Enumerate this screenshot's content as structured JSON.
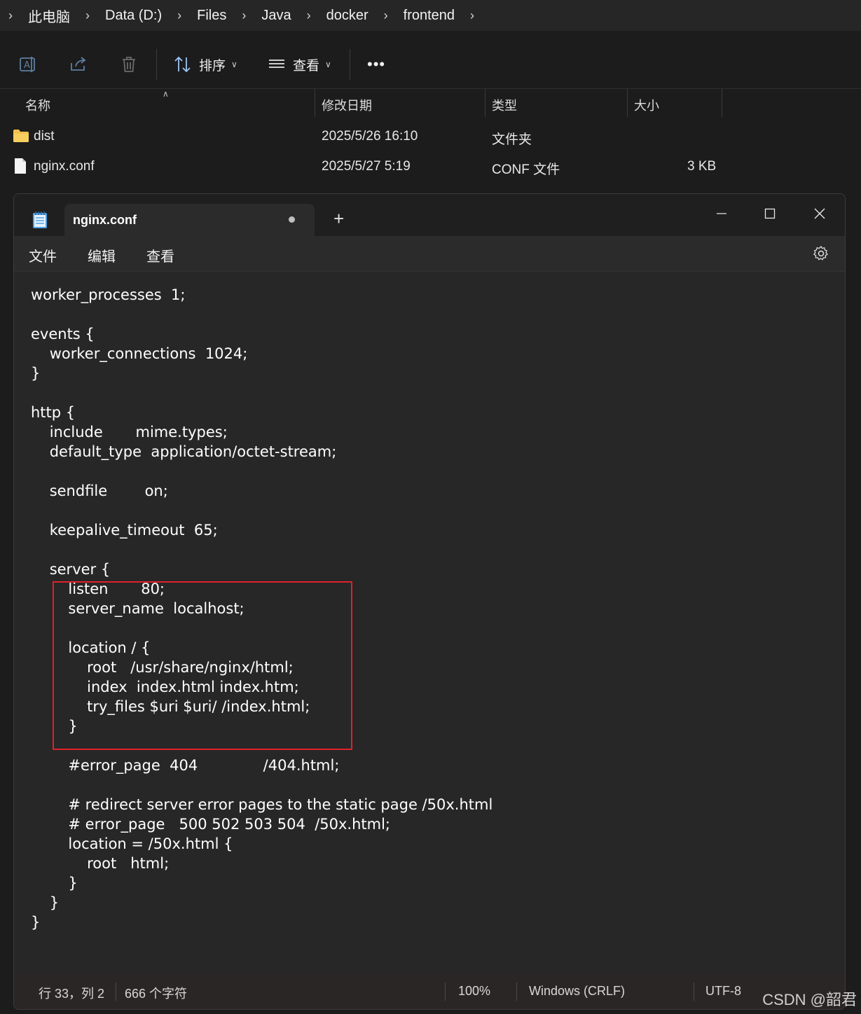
{
  "breadcrumb": [
    "此电脑",
    "Data (D:)",
    "Files",
    "Java",
    "docker",
    "frontend"
  ],
  "toolbar": {
    "sort_label": "排序",
    "view_label": "查看",
    "more_label": "•••"
  },
  "columns": {
    "name": "名称",
    "modified": "修改日期",
    "type": "类型",
    "size": "大小"
  },
  "files": [
    {
      "name": "dist",
      "modified": "2025/5/26 16:10",
      "type": "文件夹",
      "size": "",
      "icon": "folder-icon"
    },
    {
      "name": "nginx.conf",
      "modified": "2025/5/27 5:19",
      "type": "CONF 文件",
      "size": "3 KB",
      "icon": "file-icon"
    }
  ],
  "notepad": {
    "tab_title": "nginx.conf",
    "menu": {
      "file": "文件",
      "edit": "编辑",
      "view": "查看"
    },
    "content": "worker_processes  1;\n\nevents {\n    worker_connections  1024;\n}\n\nhttp {\n    include       mime.types;\n    default_type  application/octet-stream;\n\n    sendfile        on;\n\n    keepalive_timeout  65;\n\n    server {\n        listen       80;\n        server_name  localhost;\n\n        location / {\n            root   /usr/share/nginx/html;\n            index  index.html index.htm;\n            try_files $uri $uri/ /index.html;\n        }\n\n        #error_page  404              /404.html;\n\n        # redirect server error pages to the static page /50x.html\n        # error_page   500 502 503 504  /50x.html;\n        location = /50x.html {\n            root   html;\n        }\n    }\n}",
    "status": {
      "position": "行 33，列 2",
      "chars": "666 个字符",
      "zoom": "100%",
      "line_ending": "Windows (CRLF)",
      "encoding": "UTF-8"
    }
  },
  "watermark": "CSDN @韶君",
  "colors": {
    "highlight": "#e0212b",
    "folder": "#f2c14e"
  }
}
